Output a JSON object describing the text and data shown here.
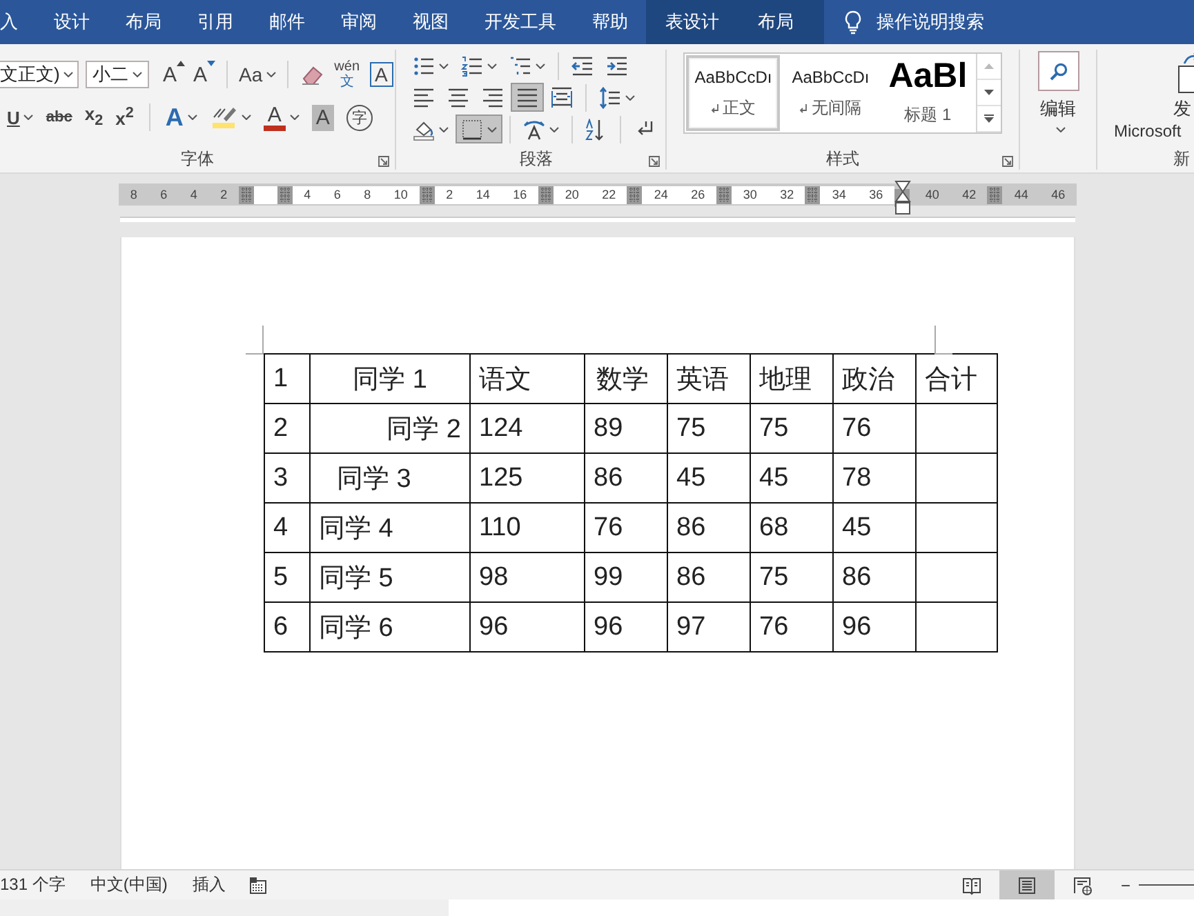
{
  "tabs": [
    {
      "label": "入",
      "contextual": false
    },
    {
      "label": "设计",
      "contextual": false
    },
    {
      "label": "布局",
      "contextual": false
    },
    {
      "label": "引用",
      "contextual": false
    },
    {
      "label": "邮件",
      "contextual": false
    },
    {
      "label": "审阅",
      "contextual": false
    },
    {
      "label": "视图",
      "contextual": false
    },
    {
      "label": "开发工具",
      "contextual": false
    },
    {
      "label": "帮助",
      "contextual": false
    },
    {
      "label": "表设计",
      "contextual": true
    },
    {
      "label": "布局",
      "contextual": true
    }
  ],
  "search": {
    "label": "操作说明搜索"
  },
  "font_group": {
    "label": "字体",
    "font": "文正文)",
    "size": "小二",
    "row1": [
      {
        "kind": "grow",
        "label": "A",
        "dropdown": false
      },
      {
        "kind": "shrink",
        "label": "A",
        "dropdown": false
      },
      {
        "kind": "sep"
      },
      {
        "kind": "case",
        "label": "Aa",
        "dropdown": true
      },
      {
        "kind": "sep"
      },
      {
        "kind": "eraser",
        "dropdown": false
      },
      {
        "kind": "phonetic",
        "label": "wén",
        "sub": "文",
        "dropdown": false
      },
      {
        "kind": "boxed",
        "label": "A",
        "dropdown": false
      }
    ],
    "row2": [
      {
        "kind": "underline",
        "label": "U",
        "dropdown": true
      },
      {
        "kind": "strike",
        "label": "abc",
        "dropdown": false
      },
      {
        "kind": "script",
        "label": "x$_{2}$",
        "dropdown": false
      },
      {
        "kind": "script",
        "label": "x$^{2}$",
        "dropdown": false
      },
      {
        "kind": "sep"
      },
      {
        "kind": "effect",
        "label": "A",
        "dropdown": true
      },
      {
        "kind": "highlight",
        "dropdown": true
      },
      {
        "kind": "color",
        "label": "A",
        "dropdown": true
      },
      {
        "kind": "shade",
        "label": "A",
        "dropdown": false
      },
      {
        "kind": "circle",
        "label": "字",
        "dropdown": false
      }
    ]
  },
  "paragraph_group": {
    "label": "段落",
    "rows": [
      [
        {
          "kind": "bullets",
          "dropdown": true,
          "selected": false
        },
        {
          "kind": "numbering",
          "dropdown": true,
          "selected": false
        },
        {
          "kind": "multilevel",
          "dropdown": true,
          "selected": false
        },
        {
          "kind": "sep"
        },
        {
          "kind": "outdent",
          "dropdown": false,
          "selected": false
        },
        {
          "kind": "indent",
          "dropdown": false,
          "selected": false
        }
      ],
      [
        {
          "kind": "align-left",
          "dropdown": false,
          "selected": false
        },
        {
          "kind": "align-center",
          "dropdown": false,
          "selected": false
        },
        {
          "kind": "align-right",
          "dropdown": false,
          "selected": false
        },
        {
          "kind": "justify",
          "dropdown": false,
          "selected": true
        },
        {
          "kind": "distribute",
          "dropdown": false,
          "selected": false
        },
        {
          "kind": "sep"
        },
        {
          "kind": "line-spacing",
          "dropdown": true,
          "selected": false
        }
      ],
      [
        {
          "kind": "shading",
          "dropdown": true,
          "selected": false
        },
        {
          "kind": "borders",
          "dropdown": true,
          "selected": true
        },
        {
          "kind": "sep"
        },
        {
          "kind": "text-direction",
          "dropdown": true,
          "selected": false
        },
        {
          "kind": "sep"
        },
        {
          "kind": "sort",
          "dropdown": false,
          "selected": false
        },
        {
          "kind": "sep"
        },
        {
          "kind": "marks",
          "dropdown": false,
          "selected": false
        }
      ]
    ]
  },
  "styles_group": {
    "label": "样式",
    "styles": [
      {
        "kind": "body",
        "preview": "AaBbCcDı",
        "name": "正文",
        "selected": true
      },
      {
        "kind": "body",
        "preview": "AaBbCcDı",
        "name": "无间隔",
        "selected": false
      },
      {
        "kind": "heading",
        "preview": "AaBl",
        "name": "标题 1",
        "selected": false
      }
    ]
  },
  "editing": {
    "label": "编辑"
  },
  "send_group": {
    "label": "发",
    "sublabel": "Microsoft",
    "group": "新"
  },
  "ruler": {
    "segments": [
      {
        "kind": "margin",
        "labels": [
          "8",
          "6",
          "4",
          "2"
        ]
      },
      {
        "kind": "marker"
      },
      {
        "kind": "text"
      },
      {
        "kind": "marker"
      },
      {
        "kind": "text",
        "labels": [
          "4",
          "6",
          "8",
          "10"
        ]
      },
      {
        "kind": "marker"
      },
      {
        "kind": "text",
        "labels": [
          "2",
          "14",
          "16"
        ]
      },
      {
        "kind": "marker"
      },
      {
        "kind": "text",
        "labels": [
          "20",
          "22"
        ]
      },
      {
        "kind": "marker"
      },
      {
        "kind": "text",
        "labels": [
          "24",
          "26"
        ]
      },
      {
        "kind": "marker"
      },
      {
        "kind": "text",
        "labels": [
          "30",
          "32"
        ]
      },
      {
        "kind": "marker"
      },
      {
        "kind": "text",
        "labels": [
          "34",
          "36"
        ]
      },
      {
        "kind": "indent"
      },
      {
        "kind": "margin",
        "labels": [
          "40",
          "42"
        ]
      },
      {
        "kind": "marker"
      },
      {
        "kind": "margin",
        "labels": [
          "44",
          "46"
        ]
      }
    ]
  },
  "table": {
    "rows": [
      [
        {
          "text": "1",
          "kind": "left"
        },
        {
          "text": "同学 1",
          "kind": "center"
        },
        {
          "text": "语文",
          "kind": "left"
        },
        {
          "text": "数学",
          "kind": "indent"
        },
        {
          "text": "英语",
          "kind": "left"
        },
        {
          "text": "地理",
          "kind": "left"
        },
        {
          "text": "政治",
          "kind": "left"
        },
        {
          "text": "合计",
          "kind": "left"
        }
      ],
      [
        {
          "text": "2",
          "kind": "left"
        },
        {
          "text": "同学 2",
          "kind": "right"
        },
        {
          "text": "124",
          "kind": "left"
        },
        {
          "text": "89",
          "kind": "left"
        },
        {
          "text": "75",
          "kind": "left"
        },
        {
          "text": "75",
          "kind": "left"
        },
        {
          "text": "76",
          "kind": "left"
        },
        {
          "kind": "left"
        }
      ],
      [
        {
          "text": "3",
          "kind": "left"
        },
        {
          "text": "同学 3",
          "kind": "indent"
        },
        {
          "text": "125",
          "kind": "left"
        },
        {
          "text": "86",
          "kind": "left"
        },
        {
          "text": "45",
          "kind": "left"
        },
        {
          "text": "45",
          "kind": "left"
        },
        {
          "text": "78",
          "kind": "left"
        },
        {
          "kind": "left"
        }
      ],
      [
        {
          "text": "4",
          "kind": "left"
        },
        {
          "text": "同学 4",
          "kind": "left"
        },
        {
          "text": "110",
          "kind": "left"
        },
        {
          "text": "76",
          "kind": "left"
        },
        {
          "text": "86",
          "kind": "left"
        },
        {
          "text": "68",
          "kind": "left"
        },
        {
          "text": "45",
          "kind": "left"
        },
        {
          "kind": "left"
        }
      ],
      [
        {
          "text": "5",
          "kind": "left"
        },
        {
          "text": "同学 5",
          "kind": "left"
        },
        {
          "text": "98",
          "kind": "left"
        },
        {
          "text": "99",
          "kind": "left"
        },
        {
          "text": "86",
          "kind": "left"
        },
        {
          "text": "75",
          "kind": "left"
        },
        {
          "text": "86",
          "kind": "left"
        },
        {
          "kind": "left"
        }
      ],
      [
        {
          "text": "6",
          "kind": "left"
        },
        {
          "text": "同学 6",
          "kind": "left"
        },
        {
          "text": "96",
          "kind": "left"
        },
        {
          "text": "96",
          "kind": "left"
        },
        {
          "text": "97",
          "kind": "left"
        },
        {
          "text": "76",
          "kind": "left"
        },
        {
          "text": "96",
          "kind": "left"
        },
        {
          "kind": "left"
        }
      ]
    ]
  },
  "status_bar": {
    "words": "131 个字",
    "language": "中文(中国)",
    "mode": "插入",
    "views": [
      {
        "kind": "read",
        "selected": false
      },
      {
        "kind": "print",
        "selected": true
      },
      {
        "kind": "web",
        "selected": false
      }
    ],
    "zoom_out": "−"
  }
}
